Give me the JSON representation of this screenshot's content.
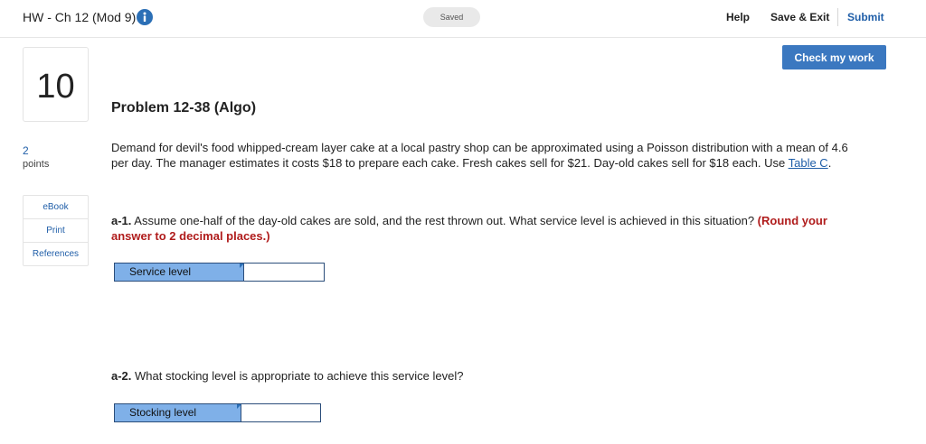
{
  "header": {
    "title": "HW - Ch 12 (Mod 9)",
    "status": "Saved",
    "help_label": "Help",
    "save_exit_label": "Save & Exit",
    "submit_label": "Submit"
  },
  "check_button_label": "Check my work",
  "question": {
    "number": "10",
    "points_value": "2",
    "points_label": "points"
  },
  "resources": [
    {
      "label": "eBook"
    },
    {
      "label": "Print"
    },
    {
      "label": "References"
    }
  ],
  "problem": {
    "title": "Problem 12-38 (Algo)",
    "text": "Demand for devil's food whipped-cream layer cake at a local pastry shop can be approximated using a Poisson distribution with a mean of 4.6 per day. The manager estimates it costs $18 to prepare each cake. Fresh cakes sell for $21. Day-old cakes sell for $18 each. Use ",
    "table_link": "Table C",
    "text_end": "."
  },
  "part_a1": {
    "label": "a-1.",
    "text": " Assume one-half of the day-old cakes are sold, and the rest thrown out. What service level is achieved in this situation? ",
    "note": "(Round your answer to 2 decimal places.)",
    "answer_label": "Service level",
    "answer_value": ""
  },
  "part_a2": {
    "label": "a-2.",
    "text": " What stocking level is appropriate to achieve this service level?",
    "answer_label": "Stocking level",
    "answer_value": ""
  },
  "colors": {
    "accent": "#3b78c0",
    "link": "#1f5ea8",
    "note_red": "#b01c1c",
    "answer_label_bg": "#7fb0e8"
  }
}
